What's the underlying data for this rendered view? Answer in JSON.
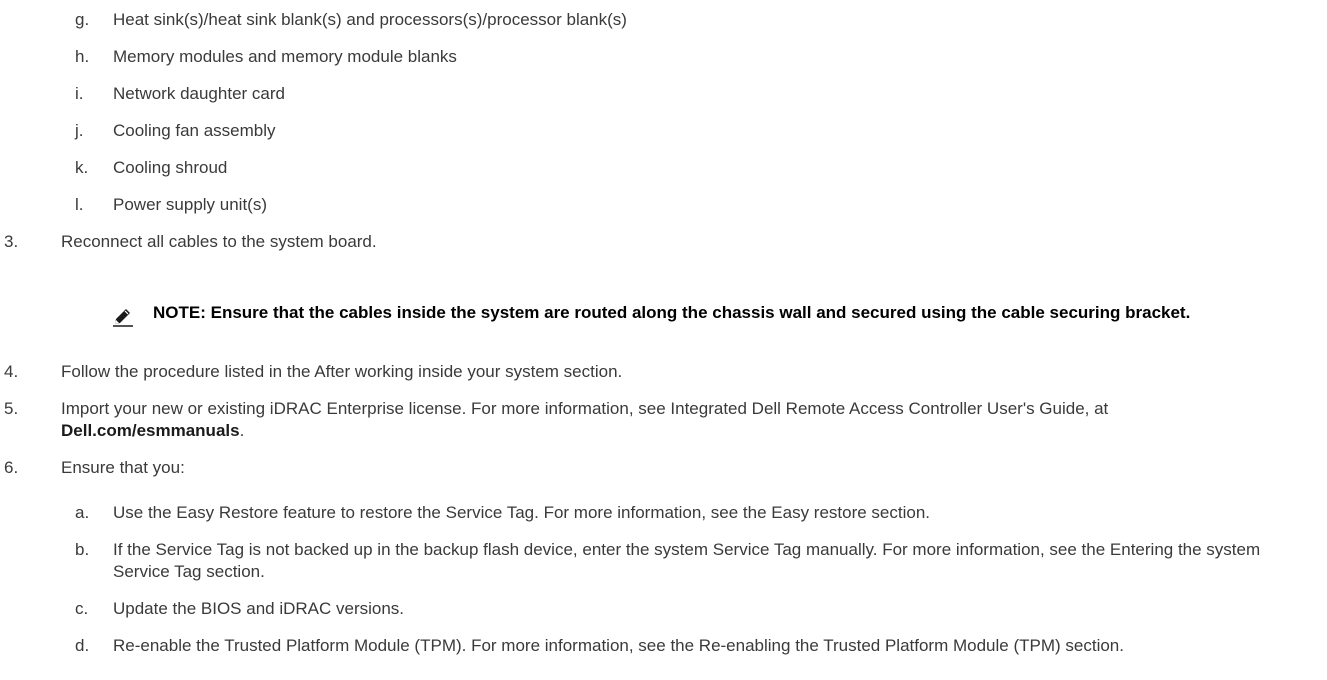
{
  "items": {
    "g": {
      "marker": "g.",
      "text": "Heat sink(s)/heat sink blank(s) and processors(s)/processor blank(s)"
    },
    "h": {
      "marker": "h.",
      "text": "Memory modules and memory module blanks"
    },
    "i": {
      "marker": "i.",
      "text": "Network daughter card"
    },
    "j": {
      "marker": "j.",
      "text": "Cooling fan assembly"
    },
    "k": {
      "marker": "k.",
      "text": "Cooling shroud"
    },
    "l": {
      "marker": "l.",
      "text": "Power supply unit(s)"
    }
  },
  "steps": {
    "s3": {
      "marker": "3.",
      "text": "Reconnect all cables to the system board."
    },
    "note": {
      "text": "NOTE: Ensure that the cables inside the system are routed along the chassis wall and secured using the cable securing bracket."
    },
    "s4": {
      "marker": "4.",
      "text": "Follow the procedure listed in the After working inside your system section."
    },
    "s5": {
      "marker": "5.",
      "text_before": "Import your new or existing iDRAC Enterprise license. For more information, see Integrated Dell Remote Access Controller User's Guide, at ",
      "link": "Dell.com/esmmanuals",
      "text_after": "."
    },
    "s6": {
      "marker": "6.",
      "text": "Ensure that you:"
    }
  },
  "substeps": {
    "a": {
      "marker": "a.",
      "text": "Use the Easy Restore feature to restore the Service Tag. For more information, see the Easy restore section."
    },
    "b": {
      "marker": "b.",
      "text": "If the Service Tag is not backed up in the backup flash device, enter the system Service Tag manually. For more information, see the Entering the system Service Tag section."
    },
    "c": {
      "marker": "c.",
      "text": "Update the BIOS and iDRAC versions."
    },
    "d": {
      "marker": "d.",
      "text": "Re-enable the Trusted Platform Module (TPM). For more information, see the Re-enabling the Trusted Platform Module (TPM) section."
    }
  }
}
